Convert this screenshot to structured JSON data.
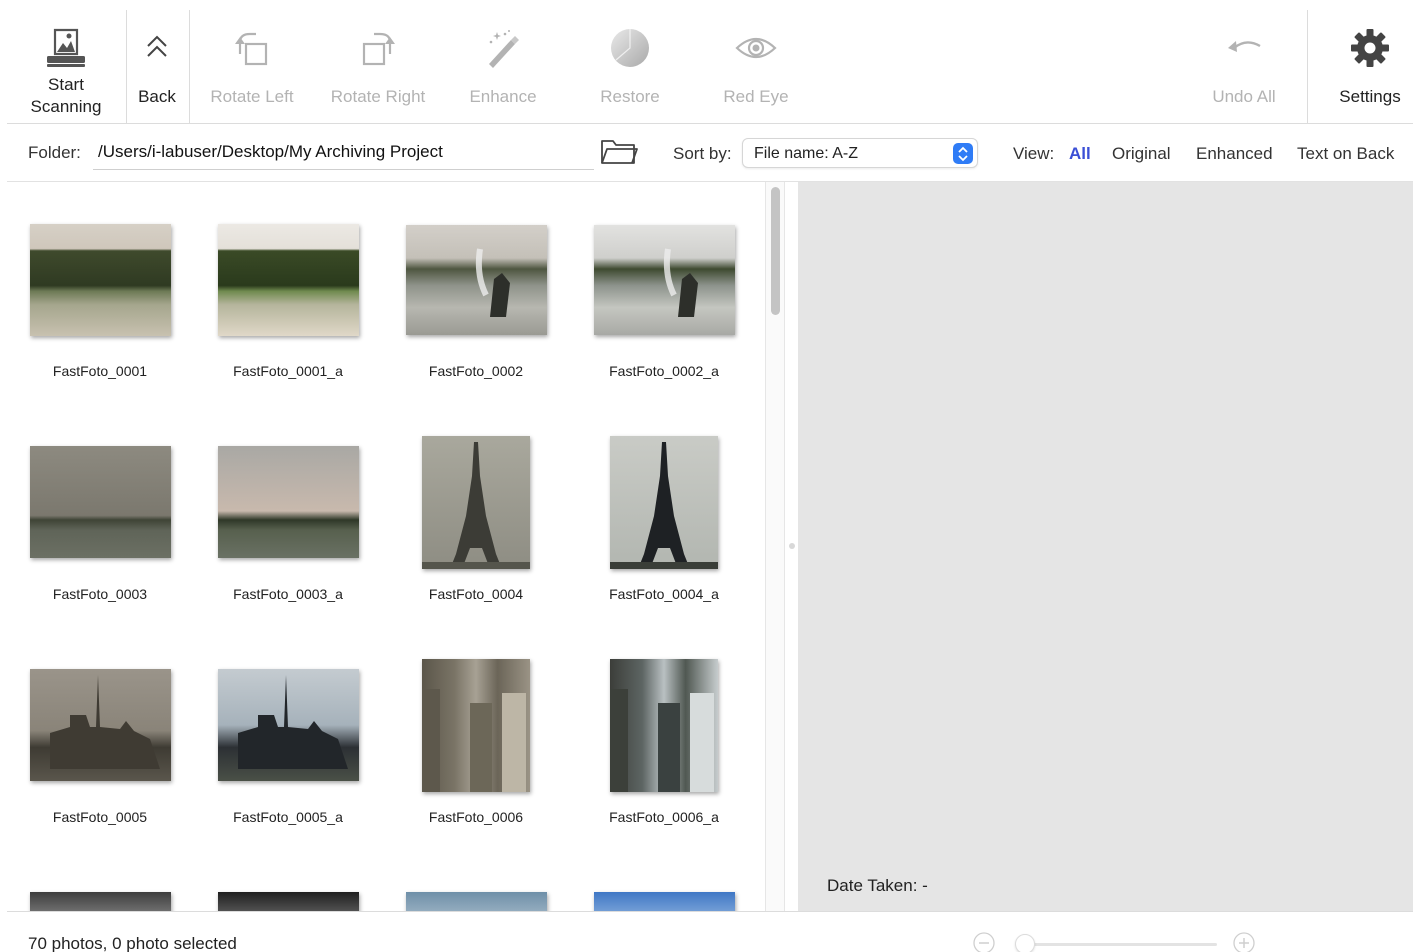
{
  "toolbar": {
    "start_scanning": "Start\nScanning",
    "back": "Back",
    "rotate_left": "Rotate Left",
    "rotate_right": "Rotate Right",
    "enhance": "Enhance",
    "restore": "Restore",
    "red_eye": "Red Eye",
    "undo_all": "Undo All",
    "settings": "Settings"
  },
  "folderbar": {
    "folder_label": "Folder:",
    "folder_path": "/Users/i-labuser/Desktop/My Archiving Project",
    "sort_label": "Sort by:",
    "sort_value": "File name: A-Z",
    "view_label": "View:",
    "view_options": [
      "All",
      "Original",
      "Enhanced",
      "Text on Back"
    ],
    "view_selected": "All"
  },
  "photos": [
    {
      "name": "FastFoto_0001",
      "scene": "garden"
    },
    {
      "name": "FastFoto_0001_a",
      "scene": "garden"
    },
    {
      "name": "FastFoto_0002",
      "scene": "fountain"
    },
    {
      "name": "FastFoto_0002_a",
      "scene": "fountain"
    },
    {
      "name": "FastFoto_0003",
      "scene": "river"
    },
    {
      "name": "FastFoto_0003_a",
      "scene": "river"
    },
    {
      "name": "FastFoto_0004",
      "scene": "eiffel"
    },
    {
      "name": "FastFoto_0004_a",
      "scene": "eiffel"
    },
    {
      "name": "FastFoto_0005",
      "scene": "cathedral"
    },
    {
      "name": "FastFoto_0005_a",
      "scene": "cathedral"
    },
    {
      "name": "FastFoto_0006",
      "scene": "towers"
    },
    {
      "name": "FastFoto_0006_a",
      "scene": "towers"
    }
  ],
  "preview": {
    "date_taken": "Date Taken: -"
  },
  "status": {
    "summary": "70 photos, 0 photo selected"
  },
  "colors": {
    "accent": "#3b4fd6",
    "stepper": "#2f7cf6",
    "disabled_text": "#b3b3b3",
    "preview_bg": "#e5e5e5"
  },
  "icons": {
    "start_scanning": "scanner-icon",
    "back": "chevron-up-double-icon",
    "rotate_left": "rotate-left-icon",
    "rotate_right": "rotate-right-icon",
    "enhance": "magic-wand-icon",
    "restore": "restore-icon",
    "red_eye": "eye-icon",
    "undo_all": "undo-icon",
    "settings": "gear-icon",
    "folder": "folder-icon",
    "zoom_out": "zoom-out-icon",
    "zoom_in": "zoom-in-icon"
  }
}
